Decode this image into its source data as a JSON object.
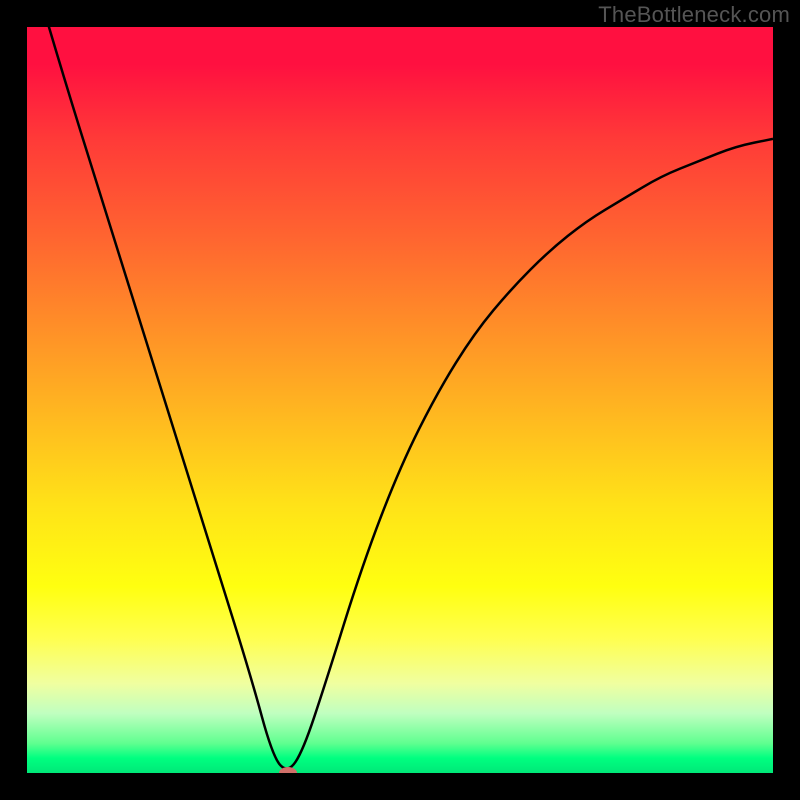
{
  "watermark": "TheBottleneck.com",
  "chart_data": {
    "type": "line",
    "title": "",
    "xlabel": "",
    "ylabel": "",
    "xlim": [
      0,
      100
    ],
    "ylim": [
      0,
      100
    ],
    "grid": false,
    "legend": false,
    "background": {
      "gradient_direction": "vertical",
      "stops": [
        {
          "pos": 0.0,
          "color": "#ff1040"
        },
        {
          "pos": 0.28,
          "color": "#ff6430"
        },
        {
          "pos": 0.52,
          "color": "#ffb820"
        },
        {
          "pos": 0.75,
          "color": "#ffff10"
        },
        {
          "pos": 0.92,
          "color": "#c0ffc0"
        },
        {
          "pos": 1.0,
          "color": "#00e878"
        }
      ]
    },
    "series": [
      {
        "name": "bottleneck-curve",
        "color": "#000000",
        "x": [
          0,
          5,
          10,
          15,
          20,
          25,
          30,
          33,
          35,
          37,
          40,
          45,
          50,
          55,
          60,
          65,
          70,
          75,
          80,
          85,
          90,
          95,
          100
        ],
        "y": [
          110,
          93,
          77,
          61,
          45,
          29,
          13,
          2,
          0,
          3,
          12,
          28,
          41,
          51,
          59,
          65,
          70,
          74,
          77,
          80,
          82,
          84,
          85
        ]
      }
    ],
    "marker": {
      "name": "optimal-point",
      "x": 35,
      "y": 0,
      "color": "#d0706a",
      "shape": "ellipse"
    }
  }
}
